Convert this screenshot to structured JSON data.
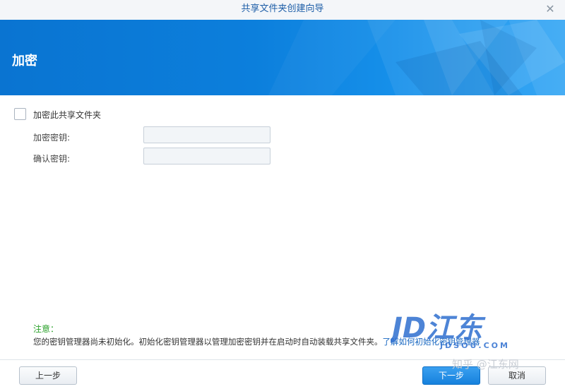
{
  "window": {
    "title": "共享文件夹创建向导"
  },
  "banner": {
    "heading": "加密"
  },
  "form": {
    "encrypt_checkbox_label": "加密此共享文件夹",
    "encrypt_checked": false,
    "key_label": "加密密钥:",
    "key_value": "",
    "confirm_label": "确认密钥:",
    "confirm_value": ""
  },
  "note": {
    "title": "注意：",
    "text": "您的密钥管理器尚未初始化。初始化密钥管理器以管理加密密钥并在启动时自动装载共享文件夹。",
    "link": "了解如何初始化密钥管理器"
  },
  "buttons": {
    "prev": "上一步",
    "next": "下一步",
    "cancel": "取消"
  },
  "watermark": {
    "logo": "JD江东",
    "sub": "JDSOU.COM",
    "site": "知乎 @江东网"
  },
  "colors": {
    "banner": "#0c7fdc",
    "accent_button": "#1681dd",
    "note_title": "#2aa12a",
    "title_text": "#1f5fa8"
  },
  "icons": {
    "close": "close-icon"
  }
}
